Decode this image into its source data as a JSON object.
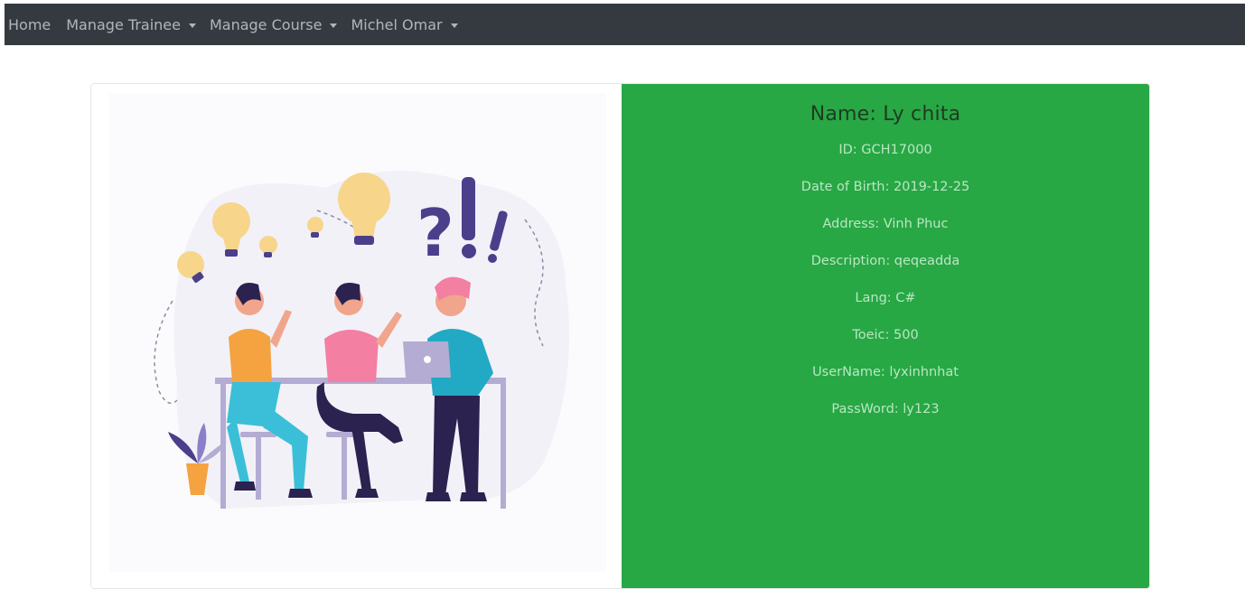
{
  "navbar": {
    "home": "Home",
    "manage_trainee": "Manage Trainee",
    "manage_course": "Manage Course",
    "user_name": "Michel Omar"
  },
  "profile": {
    "name": "Name: Ly chita",
    "id": "ID: GCH17000",
    "dob": "Date of Birth: 2019-12-25",
    "address": "Address: Vinh Phuc",
    "description": "Description: qeqeadda",
    "lang": "Lang: C#",
    "toeic": "Toeic: 500",
    "username": "UserName: lyxinhnhat",
    "password": "PassWord: ly123"
  },
  "colors": {
    "navbar": "#343a40",
    "panel": "#28a745"
  },
  "illustration": "team-brainstorm-illustration"
}
